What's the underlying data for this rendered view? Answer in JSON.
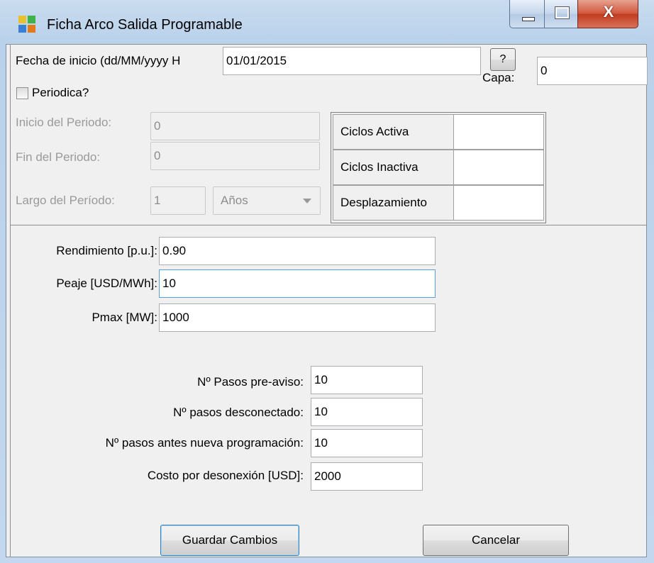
{
  "window": {
    "title": "Ficha Arco Salida Programable",
    "icon_colors": [
      "#e8c030",
      "#3fb24a",
      "#3a7fd6",
      "#e2791b"
    ],
    "close_glyph": "X"
  },
  "start_date": {
    "label": "Fecha de inicio (dd/MM/yyyy H",
    "value": "01/01/2015",
    "help_button": "?"
  },
  "capa": {
    "label": "Capa:",
    "value": "0"
  },
  "periodic": {
    "label": "Periodica?",
    "checked": false
  },
  "period": {
    "start_label": "Inicio del Periodo:",
    "start_value": "0",
    "end_label": "Fin del Periodo:",
    "end_value": "0",
    "length_label": "Largo del Período:",
    "length_value": "1",
    "unit_value": "Años"
  },
  "cycles_grid": {
    "rows": [
      {
        "label": "Ciclos Activa",
        "value": ""
      },
      {
        "label": "Ciclos Inactiva",
        "value": ""
      },
      {
        "label": "Desplazamiento",
        "value": ""
      }
    ]
  },
  "params": {
    "rendimiento_label": "Rendimiento [p.u.]:",
    "rendimiento_value": "0.90",
    "peaje_label": "Peaje [USD/MWh]:",
    "peaje_value": "10",
    "pmax_label": "Pmax [MW]:",
    "pmax_value": "1000"
  },
  "steps": {
    "preaviso_label": "Nº Pasos pre-aviso:",
    "preaviso_value": "10",
    "desconectado_label": "Nº pasos desconectado:",
    "desconectado_value": "10",
    "antes_label": "Nº pasos antes nueva programación:",
    "antes_value": "10",
    "costo_label": "Costo por desonexión [USD]:",
    "costo_value": "2000"
  },
  "actions": {
    "save": "Guardar Cambios",
    "cancel": "Cancelar"
  }
}
